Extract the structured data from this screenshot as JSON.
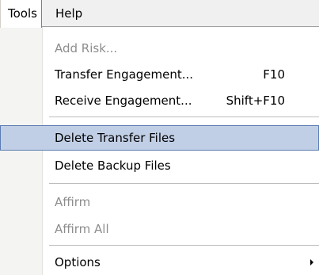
{
  "menubar": {
    "tools_label": "Tools",
    "help_label": "Help"
  },
  "menu": {
    "add_risk": "Add Risk...",
    "transfer_engagement": "Transfer Engagement...",
    "transfer_engagement_shortcut": "F10",
    "receive_engagement": "Receive Engagement...",
    "receive_engagement_shortcut": "Shift+F10",
    "delete_transfer_files": "Delete Transfer Files",
    "delete_backup_files": "Delete Backup Files",
    "affirm": "Affirm",
    "affirm_all": "Affirm All",
    "options": "Options"
  },
  "colors": {
    "highlight_fill": "#c1cfe6",
    "highlight_border": "#5a7bb0",
    "disabled_text": "#8d8d8d"
  }
}
